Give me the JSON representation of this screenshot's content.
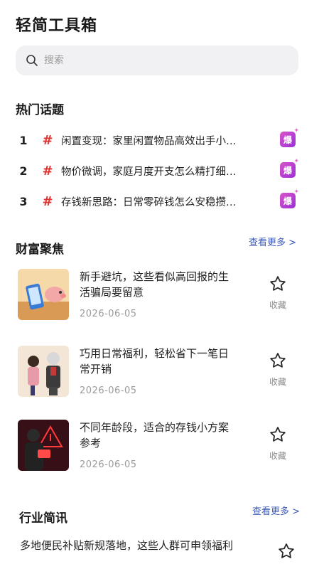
{
  "app": {
    "title": "轻简工具箱"
  },
  "search": {
    "placeholder": "搜索"
  },
  "hot": {
    "title": "热门话题",
    "badge": "爆",
    "items": [
      {
        "rank": "1",
        "hash": "#",
        "text": "闲置变现：家里闲置物品高效出手小…"
      },
      {
        "rank": "2",
        "hash": "#",
        "text": "物价微调，家庭月度开支怎么精打细…"
      },
      {
        "rank": "3",
        "hash": "#",
        "text": "存钱新思路：日常零碎钱怎么安稳攒…"
      }
    ]
  },
  "wealth": {
    "title": "财富聚焦",
    "more": "查看更多 >",
    "fav_label": "收藏",
    "items": [
      {
        "title": "新手避坑，这些看似高回报的生活骗局要留意",
        "date": "2026-06-05"
      },
      {
        "title": "巧用日常福利，轻松省下一笔日常开销",
        "date": "2026-06-05"
      },
      {
        "title": "不同年龄段，适合的存钱小方案参考",
        "date": "2026-06-05"
      }
    ]
  },
  "news": {
    "title": "行业简讯",
    "more": "查看更多 >",
    "items": [
      {
        "title": "多地便民补贴新规落地，这些人群可申领福利"
      }
    ]
  },
  "colors": {
    "accent_red": "#e0322f",
    "link_blue": "#3a59b8",
    "badge_purple": "#b33fd3"
  }
}
